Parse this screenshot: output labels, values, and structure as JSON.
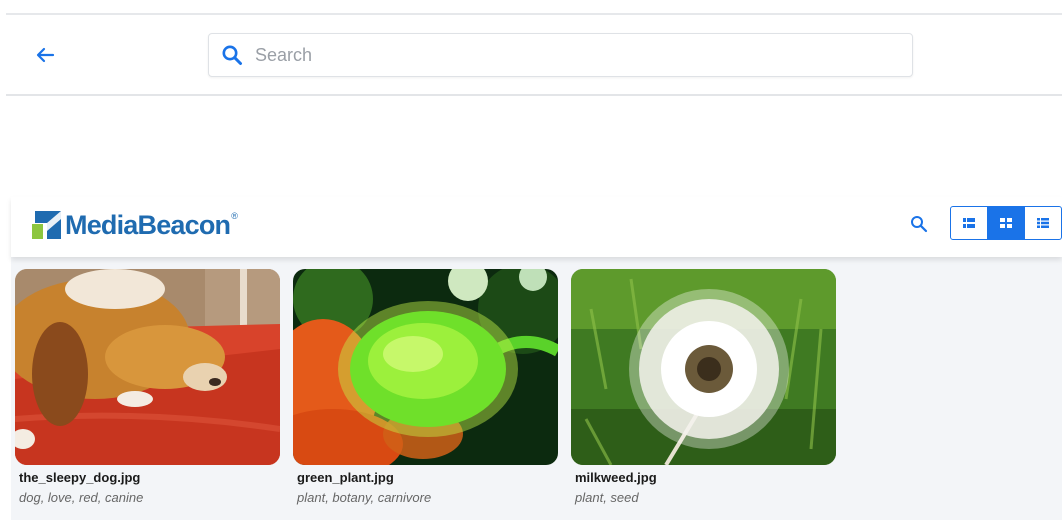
{
  "search": {
    "placeholder": "Search",
    "value": ""
  },
  "header": {
    "logo_text": "MediaBeacon",
    "logo_mark": "®"
  },
  "view_modes": [
    "list-view",
    "grid-view",
    "table-view"
  ],
  "active_view": "grid-view",
  "assets": [
    {
      "filename": "the_sleepy_dog.jpg",
      "tags": "dog, love, red, canine"
    },
    {
      "filename": "green_plant.jpg",
      "tags": "plant, botany, carnivore"
    },
    {
      "filename": "milkweed.jpg",
      "tags": "plant, seed"
    }
  ],
  "colors": {
    "accent": "#1a73e8",
    "brand_blue": "#1f6bb0",
    "brand_green": "#8dc63f",
    "gallery_bg": "#f3f5f8"
  },
  "icons": [
    "back-arrow-icon",
    "search-icon",
    "list-view-icon",
    "grid-view-icon",
    "table-view-icon"
  ]
}
